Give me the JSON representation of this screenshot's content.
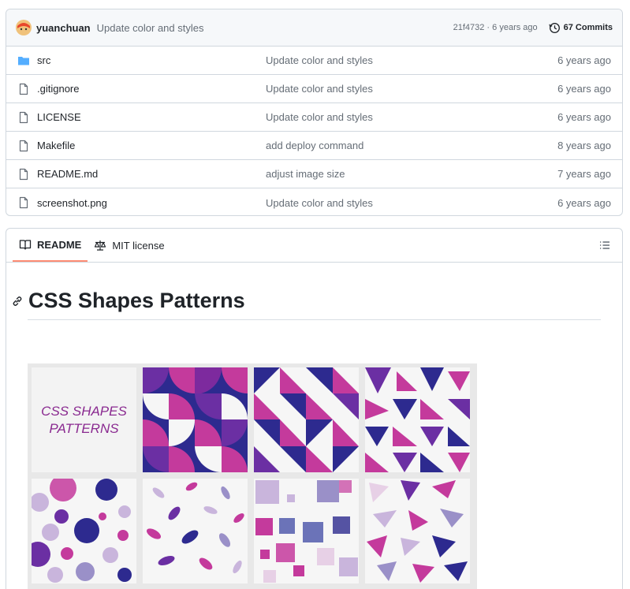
{
  "commit": {
    "author": "yuanchuan",
    "message": "Update color and styles",
    "hash": "21f4732",
    "age": "6 years ago",
    "commits_label": "67 Commits"
  },
  "files": [
    {
      "name": "src",
      "type": "folder",
      "message": "Update color and styles",
      "age": "6 years ago"
    },
    {
      "name": ".gitignore",
      "type": "file",
      "message": "Update color and styles",
      "age": "6 years ago"
    },
    {
      "name": "LICENSE",
      "type": "file",
      "message": "Update color and styles",
      "age": "6 years ago"
    },
    {
      "name": "Makefile",
      "type": "file",
      "message": "add deploy command",
      "age": "8 years ago"
    },
    {
      "name": "README.md",
      "type": "file",
      "message": "adjust image size",
      "age": "7 years ago"
    },
    {
      "name": "screenshot.png",
      "type": "file",
      "message": "Update color and styles",
      "age": "6 years ago"
    }
  ],
  "readme": {
    "tabs": [
      {
        "label": "README",
        "icon": "book-icon",
        "active": true
      },
      {
        "label": "MIT license",
        "icon": "scale-icon",
        "active": false
      }
    ],
    "title": "CSS Shapes Patterns",
    "preview_label_line1": "CSS SHAPES",
    "preview_label_line2": "PATTERNS"
  },
  "colors": {
    "accent_tab": "#fd8c73",
    "folder": "#54aeff",
    "magenta": "#c43a9c",
    "indigo": "#2d2a8f",
    "purple": "#6b2fa3"
  }
}
